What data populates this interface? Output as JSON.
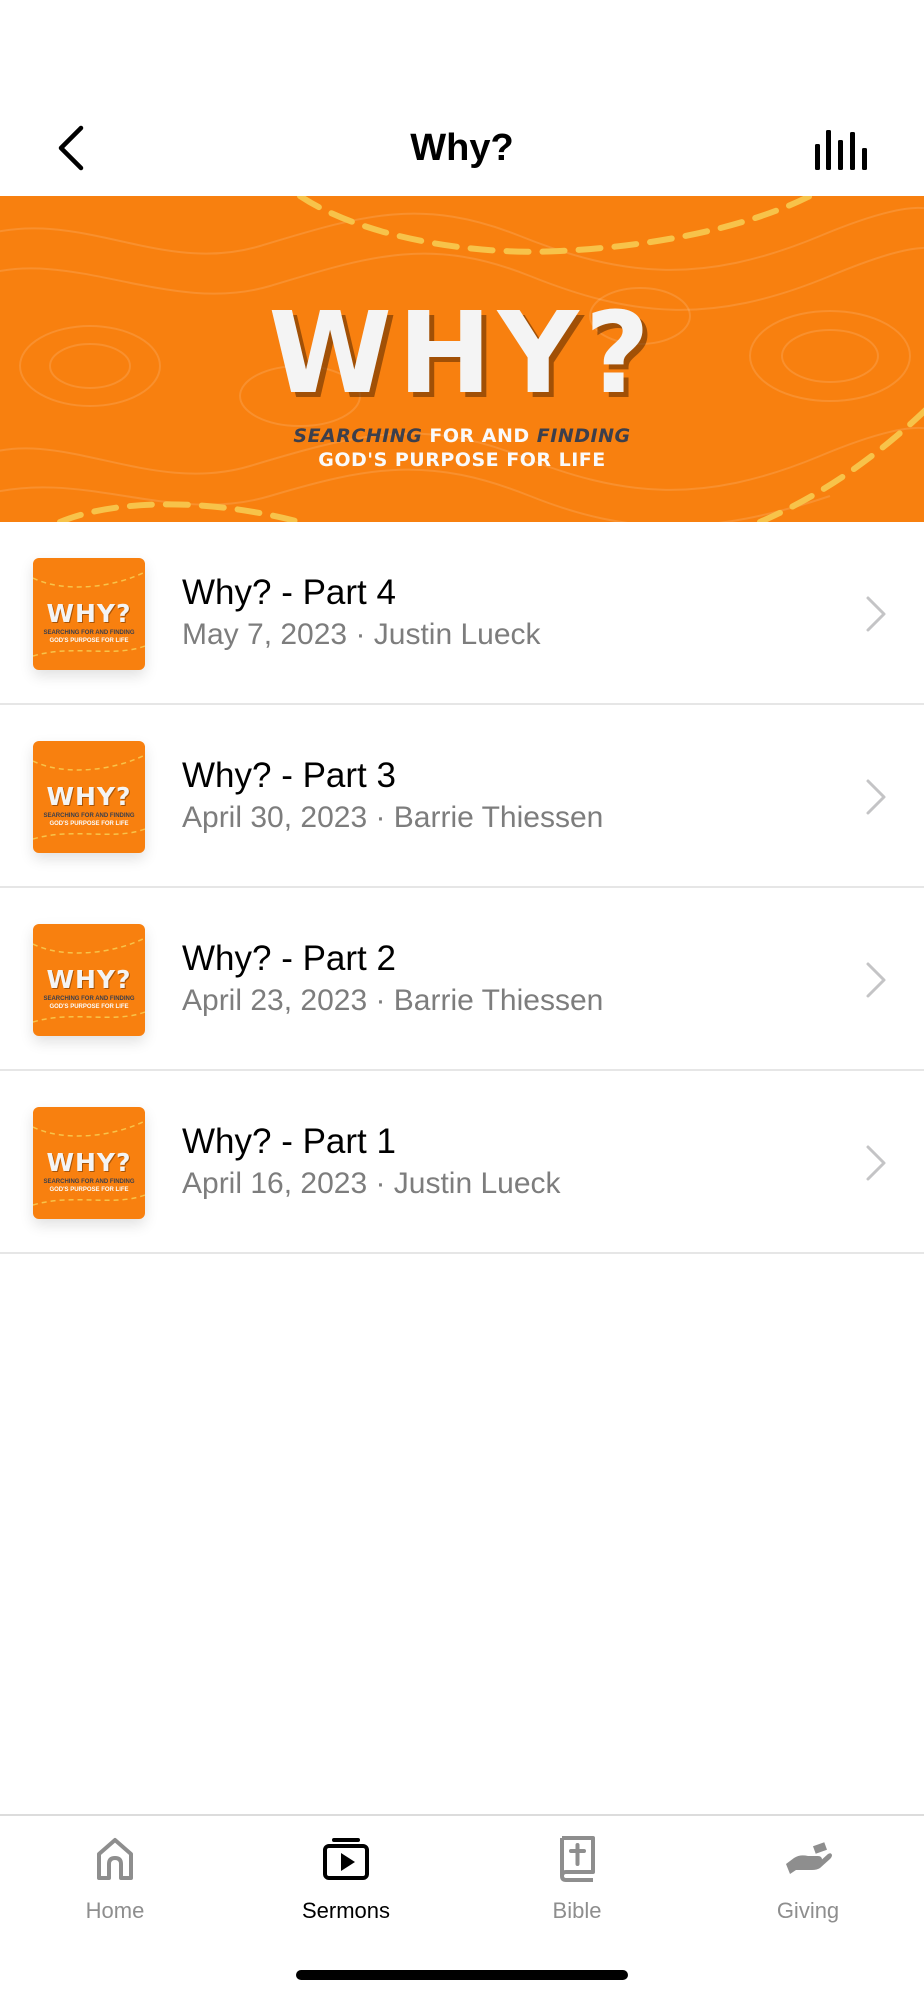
{
  "header": {
    "title": "Why?",
    "back_icon": "chevron-left-icon",
    "audio_icon": "audio-bars-icon"
  },
  "banner": {
    "title": "WHY?",
    "subtitle_line1_a": "SEARCHING",
    "subtitle_line1_b": " FOR AND ",
    "subtitle_line1_c": "FINDING",
    "subtitle_line2": "GOD'S PURPOSE FOR LIFE",
    "background_color": "#f8800f",
    "accent_color": "#f7c34a"
  },
  "thumb": {
    "word": "WHY?",
    "sub1": "SEARCHING FOR AND FINDING",
    "sub2": "GOD'S PURPOSE FOR LIFE"
  },
  "sermons": [
    {
      "title": "Why? - Part 4",
      "meta": "May 7, 2023 · Justin Lueck"
    },
    {
      "title": "Why? - Part 3",
      "meta": "April 30, 2023 · Barrie Thiessen"
    },
    {
      "title": "Why? - Part 2",
      "meta": "April 23, 2023 · Barrie Thiessen"
    },
    {
      "title": "Why? - Part 1",
      "meta": "April 16, 2023 · Justin Lueck"
    }
  ],
  "tabs": [
    {
      "label": "Home",
      "icon": "home-icon",
      "active": false
    },
    {
      "label": "Sermons",
      "icon": "sermons-play-icon",
      "active": true
    },
    {
      "label": "Bible",
      "icon": "bible-icon",
      "active": false
    },
    {
      "label": "Giving",
      "icon": "giving-hand-icon",
      "active": false
    }
  ]
}
